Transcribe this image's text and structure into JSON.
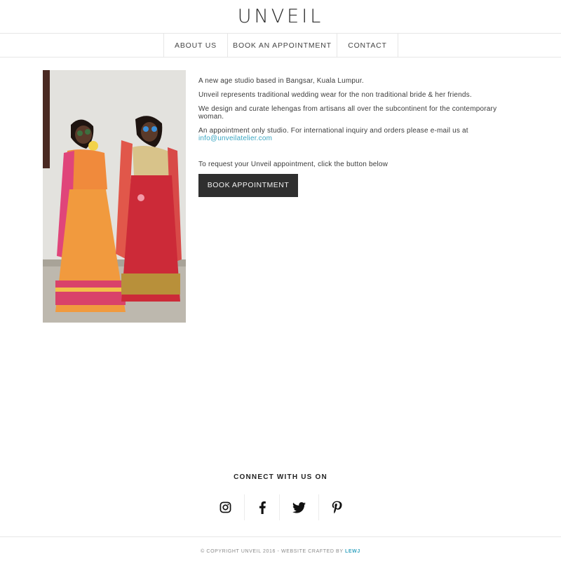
{
  "header": {
    "logo": "UNVEIL"
  },
  "nav": {
    "items": [
      {
        "label": "ABOUT US"
      },
      {
        "label": "BOOK AN APPOINTMENT"
      },
      {
        "label": "CONTACT"
      }
    ]
  },
  "main": {
    "photo_icon": "two-women-in-lehengas-photo",
    "paragraphs": [
      "A new age studio based in Bangsar, Kuala Lumpur.",
      "Unveil represents traditional wedding wear for the non traditional bride & her friends.",
      "We design and curate lehengas from artisans all over the subcontinent for the contemporary woman.",
      "An appointment only studio. For international inquiry and orders please e-mail us at"
    ],
    "email": "info@unveilatelier.com",
    "request_text": "To request your Unveil appointment, click the button below",
    "book_button": "BOOK APPOINTMENT"
  },
  "social": {
    "title": "CONNECT WITH US ON",
    "icons": [
      "instagram-icon",
      "facebook-icon",
      "twitter-icon",
      "pinterest-icon"
    ]
  },
  "footer": {
    "text": "© COPYRIGHT UNVEIL 2016 - WEBSITE CRAFTED BY",
    "credit": "LEWJ"
  },
  "colors": {
    "accent": "#3aa6c2",
    "button_bg": "#2f2f2f",
    "border": "#e6e6e6"
  }
}
